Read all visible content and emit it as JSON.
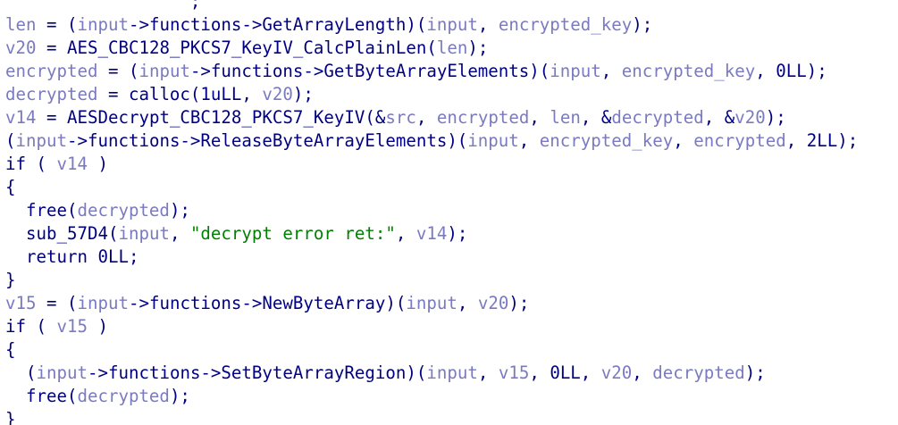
{
  "editor": {
    "colors": {
      "background": "#ffffff",
      "plain": "#000080",
      "variable": "#7a7ac0",
      "string": "#008000"
    },
    "lines": [
      [
        {
          "t": "pun",
          "s": "                  ;"
        }
      ],
      [
        {
          "t": "var",
          "s": "len"
        },
        {
          "t": "pun",
          "s": " = ("
        },
        {
          "t": "var",
          "s": "input"
        },
        {
          "t": "pun",
          "s": "->functions->GetArrayLength)("
        },
        {
          "t": "var",
          "s": "input"
        },
        {
          "t": "pun",
          "s": ", "
        },
        {
          "t": "var",
          "s": "encrypted_key"
        },
        {
          "t": "pun",
          "s": ");"
        }
      ],
      [
        {
          "t": "var",
          "s": "v20"
        },
        {
          "t": "pun",
          "s": " = AES_CBC128_PKCS7_KeyIV_CalcPlainLen("
        },
        {
          "t": "var",
          "s": "len"
        },
        {
          "t": "pun",
          "s": ");"
        }
      ],
      [
        {
          "t": "var",
          "s": "encrypted"
        },
        {
          "t": "pun",
          "s": " = ("
        },
        {
          "t": "var",
          "s": "input"
        },
        {
          "t": "pun",
          "s": "->functions->GetByteArrayElements)("
        },
        {
          "t": "var",
          "s": "input"
        },
        {
          "t": "pun",
          "s": ", "
        },
        {
          "t": "var",
          "s": "encrypted_key"
        },
        {
          "t": "pun",
          "s": ", 0LL);"
        }
      ],
      [
        {
          "t": "var",
          "s": "decrypted"
        },
        {
          "t": "pun",
          "s": " = calloc(1uLL, "
        },
        {
          "t": "var",
          "s": "v20"
        },
        {
          "t": "pun",
          "s": ");"
        }
      ],
      [
        {
          "t": "var",
          "s": "v14"
        },
        {
          "t": "pun",
          "s": " = AESDecrypt_CBC128_PKCS7_KeyIV(&"
        },
        {
          "t": "var",
          "s": "src"
        },
        {
          "t": "pun",
          "s": ", "
        },
        {
          "t": "var",
          "s": "encrypted"
        },
        {
          "t": "pun",
          "s": ", "
        },
        {
          "t": "var",
          "s": "len"
        },
        {
          "t": "pun",
          "s": ", &"
        },
        {
          "t": "var",
          "s": "decrypted"
        },
        {
          "t": "pun",
          "s": ", &"
        },
        {
          "t": "var",
          "s": "v20"
        },
        {
          "t": "pun",
          "s": ");"
        }
      ],
      [
        {
          "t": "pun",
          "s": "("
        },
        {
          "t": "var",
          "s": "input"
        },
        {
          "t": "pun",
          "s": "->functions->ReleaseByteArrayElements)("
        },
        {
          "t": "var",
          "s": "input"
        },
        {
          "t": "pun",
          "s": ", "
        },
        {
          "t": "var",
          "s": "encrypted_key"
        },
        {
          "t": "pun",
          "s": ", "
        },
        {
          "t": "var",
          "s": "encrypted"
        },
        {
          "t": "pun",
          "s": ", 2LL);"
        }
      ],
      [
        {
          "t": "kw",
          "s": "if"
        },
        {
          "t": "pun",
          "s": " ( "
        },
        {
          "t": "var",
          "s": "v14"
        },
        {
          "t": "pun",
          "s": " )"
        }
      ],
      [
        {
          "t": "pun",
          "s": "{"
        }
      ],
      [
        {
          "t": "pun",
          "s": "  free("
        },
        {
          "t": "var",
          "s": "decrypted"
        },
        {
          "t": "pun",
          "s": ");"
        }
      ],
      [
        {
          "t": "pun",
          "s": "  sub_57D4("
        },
        {
          "t": "var",
          "s": "input"
        },
        {
          "t": "pun",
          "s": ", "
        },
        {
          "t": "str",
          "s": "\"decrypt error ret:\""
        },
        {
          "t": "pun",
          "s": ", "
        },
        {
          "t": "var",
          "s": "v14"
        },
        {
          "t": "pun",
          "s": ");"
        }
      ],
      [
        {
          "t": "kw",
          "s": "  return"
        },
        {
          "t": "pun",
          "s": " 0LL;"
        }
      ],
      [
        {
          "t": "pun",
          "s": "}"
        }
      ],
      [
        {
          "t": "var",
          "s": "v15"
        },
        {
          "t": "pun",
          "s": " = ("
        },
        {
          "t": "var",
          "s": "input"
        },
        {
          "t": "pun",
          "s": "->functions->NewByteArray)("
        },
        {
          "t": "var",
          "s": "input"
        },
        {
          "t": "pun",
          "s": ", "
        },
        {
          "t": "var",
          "s": "v20"
        },
        {
          "t": "pun",
          "s": ");"
        }
      ],
      [
        {
          "t": "kw",
          "s": "if"
        },
        {
          "t": "pun",
          "s": " ( "
        },
        {
          "t": "var",
          "s": "v15"
        },
        {
          "t": "pun",
          "s": " )"
        }
      ],
      [
        {
          "t": "pun",
          "s": "{"
        }
      ],
      [
        {
          "t": "pun",
          "s": "  ("
        },
        {
          "t": "var",
          "s": "input"
        },
        {
          "t": "pun",
          "s": "->functions->SetByteArrayRegion)("
        },
        {
          "t": "var",
          "s": "input"
        },
        {
          "t": "pun",
          "s": ", "
        },
        {
          "t": "var",
          "s": "v15"
        },
        {
          "t": "pun",
          "s": ", 0LL, "
        },
        {
          "t": "var",
          "s": "v20"
        },
        {
          "t": "pun",
          "s": ", "
        },
        {
          "t": "var",
          "s": "decrypted"
        },
        {
          "t": "pun",
          "s": ");"
        }
      ],
      [
        {
          "t": "pun",
          "s": "  free("
        },
        {
          "t": "var",
          "s": "decrypted"
        },
        {
          "t": "pun",
          "s": ");"
        }
      ],
      [
        {
          "t": "pun",
          "s": "}"
        }
      ]
    ]
  }
}
